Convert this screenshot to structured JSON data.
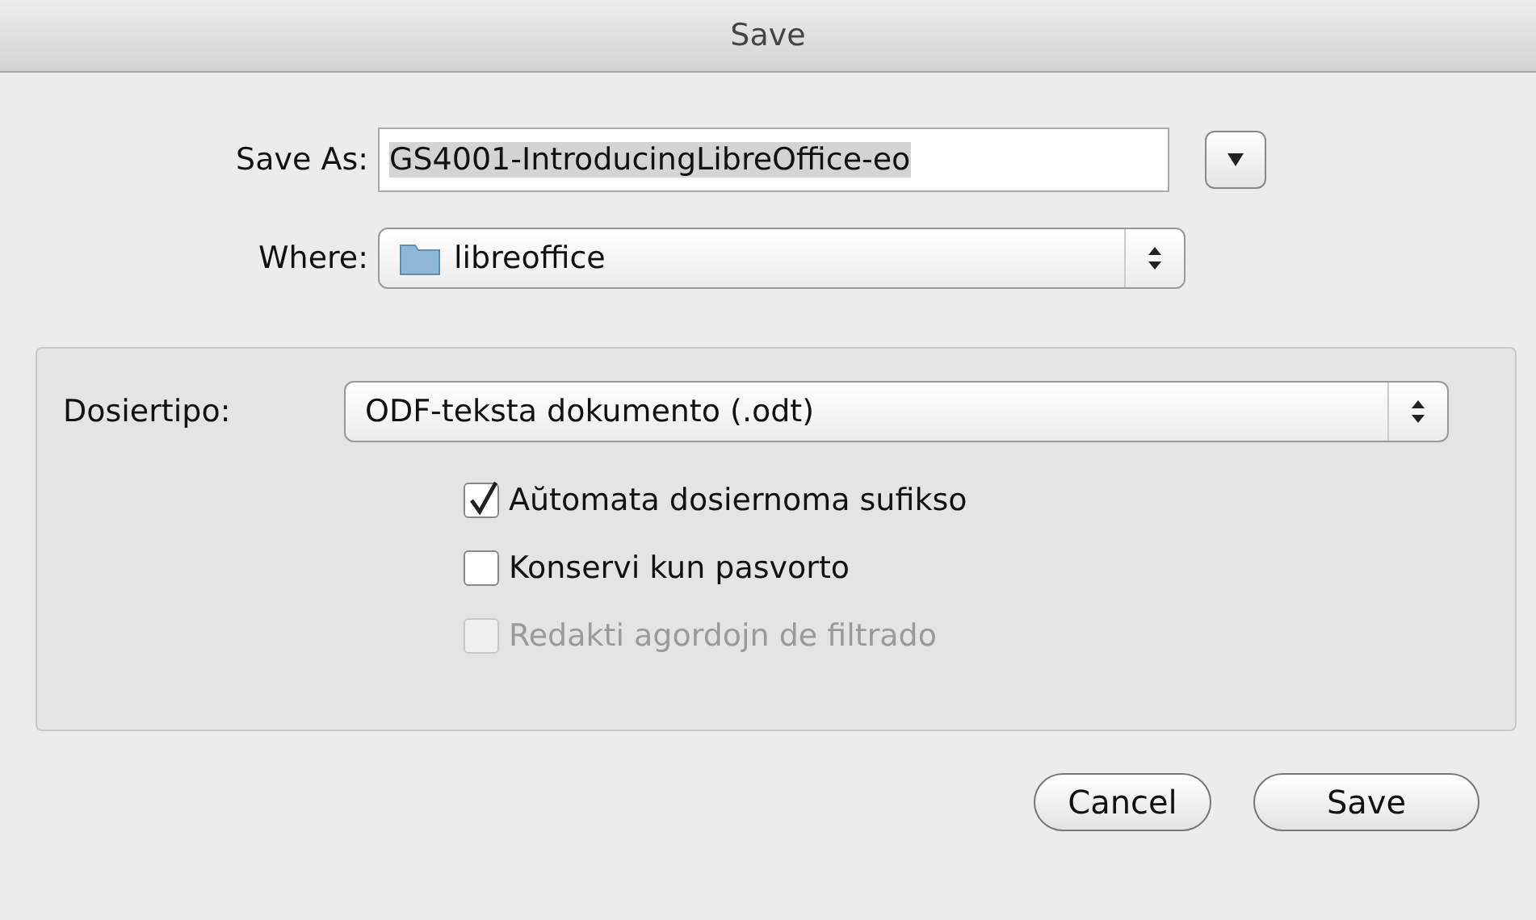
{
  "window": {
    "title": "Save"
  },
  "save_as": {
    "label": "Save As:",
    "value": "GS4001-IntroducingLibreOffice-eo",
    "text_selected": true
  },
  "where": {
    "label": "Where:",
    "value": "libreoffice"
  },
  "file_type": {
    "label": "Dosiertipo:",
    "value": "ODF-teksta dokumento (.odt)"
  },
  "options": [
    {
      "label": "Aŭtomata dosiernoma sufikso",
      "checked": true,
      "disabled": false
    },
    {
      "label": "Konservi kun pasvorto",
      "checked": false,
      "disabled": false
    },
    {
      "label": "Redakti agordojn de filtrado",
      "checked": false,
      "disabled": true
    }
  ],
  "buttons": [
    "Cancel",
    "Save"
  ]
}
